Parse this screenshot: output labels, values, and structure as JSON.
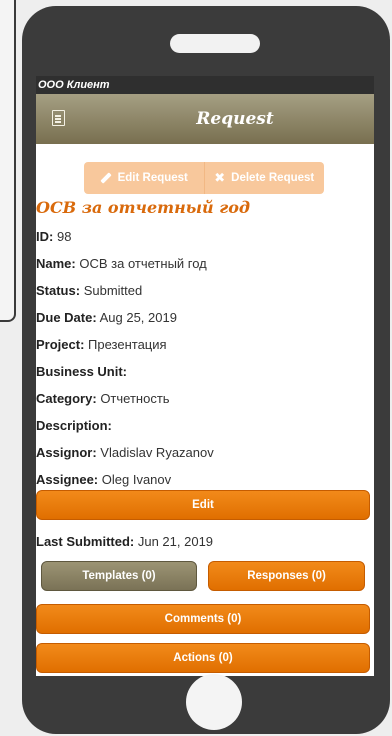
{
  "app": {
    "company": "ООО Клиент",
    "header_title": "Request"
  },
  "actions": {
    "edit_request": "Edit Request",
    "delete_request": "Delete Request"
  },
  "request": {
    "title": "ОСВ за отчетный год",
    "fields": [
      {
        "label": "ID:",
        "value": "98"
      },
      {
        "label": "Name:",
        "value": "ОСВ за отчетный год"
      },
      {
        "label": "Status:",
        "value": "Submitted"
      },
      {
        "label": "Due Date:",
        "value": "Aug 25, 2019"
      },
      {
        "label": "Project:",
        "value": "Презентация"
      },
      {
        "label": "Business Unit:",
        "value": ""
      },
      {
        "label": "Category:",
        "value": "Отчетность"
      },
      {
        "label": "Description:",
        "value": ""
      },
      {
        "label": "Assignor:",
        "value": "Vladislav Ryazanov"
      },
      {
        "label": "Assignee:",
        "value": "Oleg Ivanov"
      }
    ],
    "last_submitted": {
      "label": "Last Submitted:",
      "value": "Jun 21, 2019"
    }
  },
  "buttons": {
    "edit": "Edit",
    "templates": "Templates (0)",
    "responses": "Responses (0)",
    "comments": "Comments (0)",
    "actions": "Actions (0)"
  },
  "colors": {
    "accent": "#e87a0a",
    "title": "#d96a0c",
    "header": "#8a8265"
  }
}
